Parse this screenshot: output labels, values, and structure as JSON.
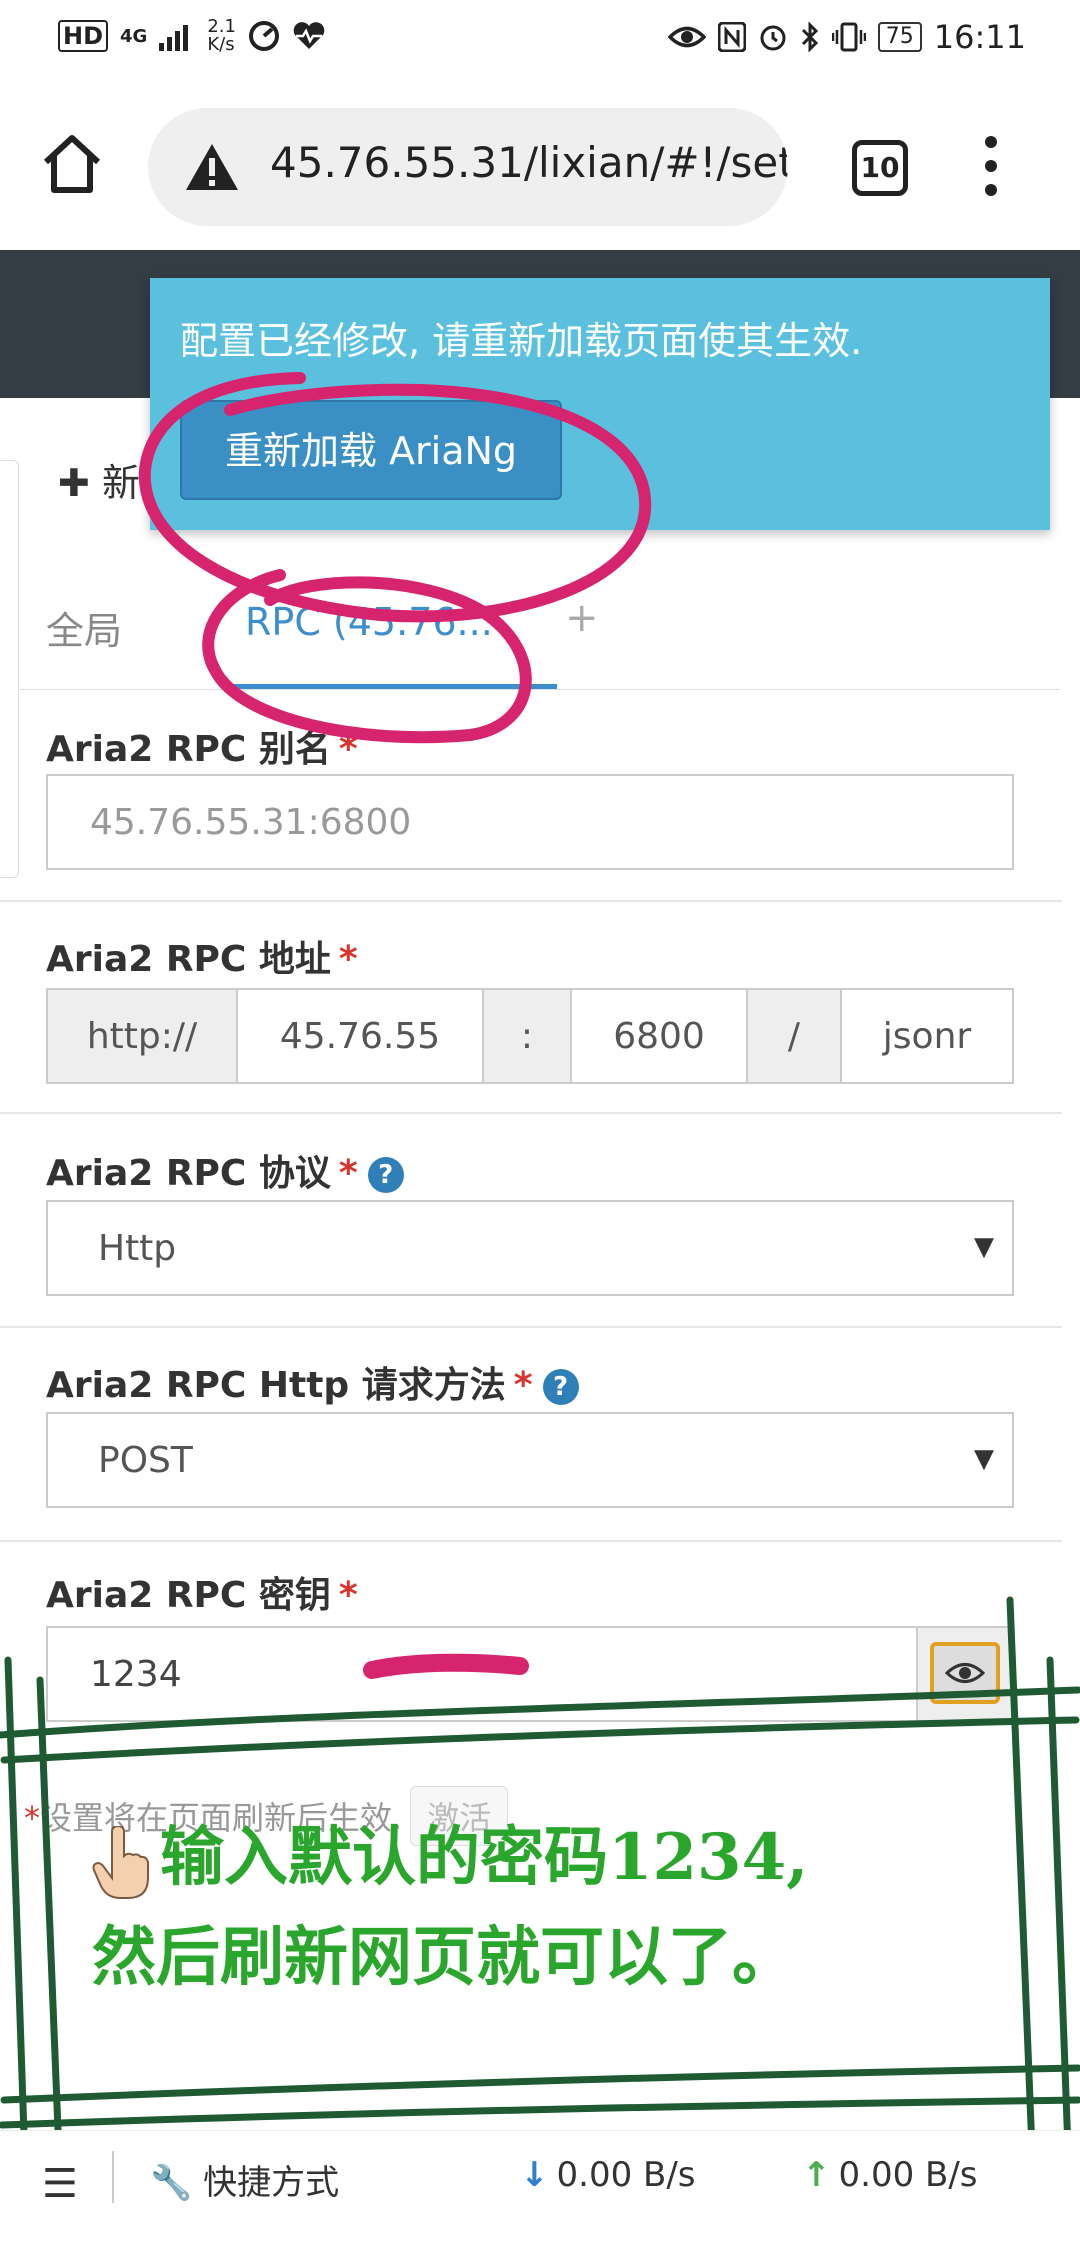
{
  "status_bar": {
    "hd": "HD",
    "network": "4G",
    "speed_top": "2.1",
    "speed_bottom": "K/s",
    "battery": "75",
    "time": "16:11"
  },
  "browser": {
    "url": "45.76.55.31/lixian/#!/set",
    "tab_count": "10"
  },
  "alert": {
    "message": "配置已经修改, 请重新加载页面使其生效.",
    "reload_button": "重新加载 AriaNg"
  },
  "toolbar": {
    "new_label": "新"
  },
  "tabs": {
    "global": "全局",
    "rpc": "RPC (45.76...",
    "add": "+"
  },
  "form": {
    "alias": {
      "label": "Aria2 RPC 别名",
      "required": "*",
      "placeholder": "45.76.55.31:6800"
    },
    "address": {
      "label": "Aria2 RPC 地址",
      "required": "*",
      "protocol": "http://",
      "host": "45.76.55",
      "colon": ":",
      "port": "6800",
      "slash": "/",
      "path": "jsonr"
    },
    "protocol": {
      "label": "Aria2 RPC 协议",
      "required": "*",
      "help": "?",
      "value": "Http"
    },
    "method": {
      "label": "Aria2 RPC Http 请求方法",
      "required": "*",
      "help": "?",
      "value": "POST"
    },
    "secret": {
      "label": "Aria2 RPC 密钥",
      "required": "*",
      "value": "1234"
    }
  },
  "note": {
    "asterisk": "*",
    "text": "设置将在页面刷新后生效.",
    "activate": "激活"
  },
  "annotation": {
    "line1": "输入默认的密码1234,",
    "line2": "然后刷新网页就可以了。"
  },
  "bottom_bar": {
    "shortcut": "快捷方式",
    "download_speed": "0.00 B/s",
    "upload_speed": "0.00 B/s"
  },
  "colors": {
    "alert_bg": "#5bc0de",
    "reload_btn": "#3a8fc4",
    "app_header": "#343c44",
    "tab_active": "#3d8ecf",
    "required": "#d9342b",
    "annotation_text": "#2aa62d",
    "circle_marks": "#d6246e",
    "frame_lines": "#1f5a33"
  }
}
